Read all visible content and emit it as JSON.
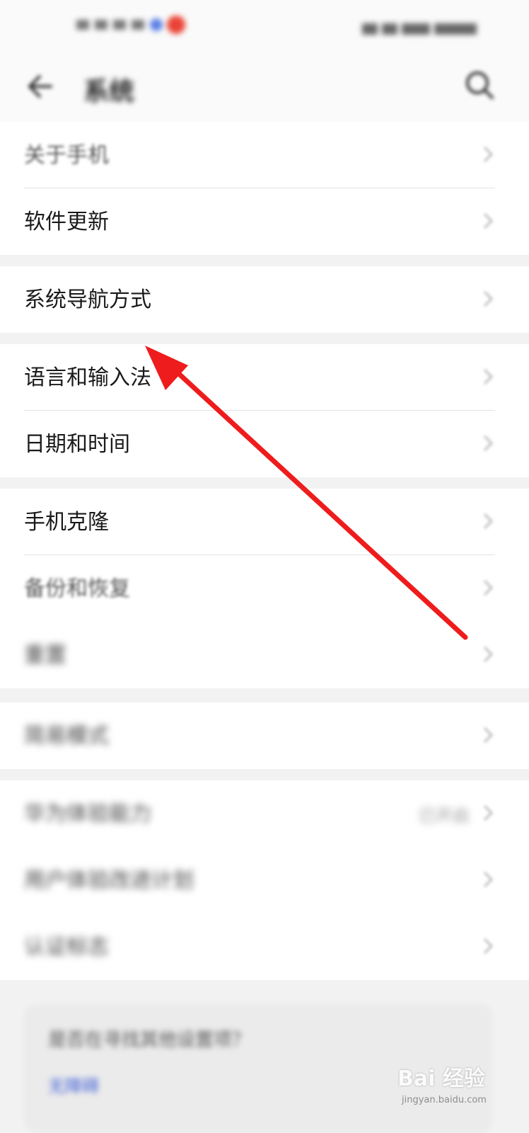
{
  "status_bar": {},
  "header": {
    "title": "系统",
    "back_icon": "arrow-left-icon",
    "search_icon": "search-icon"
  },
  "groups": [
    {
      "items": [
        {
          "label": "关于手机"
        },
        {
          "label": "软件更新"
        }
      ]
    },
    {
      "items": [
        {
          "label": "系统导航方式"
        }
      ]
    },
    {
      "items": [
        {
          "label": "语言和输入法"
        },
        {
          "label": "日期和时间"
        }
      ]
    },
    {
      "items": [
        {
          "label": "手机克隆"
        },
        {
          "label": "备份和恢复"
        },
        {
          "label": "重置"
        }
      ]
    },
    {
      "items": [
        {
          "label": "简易模式"
        }
      ]
    },
    {
      "items": [
        {
          "label": "华为体验能力",
          "value": "已开启"
        },
        {
          "label": "用户体验改进计划"
        },
        {
          "label": "认证标志"
        }
      ]
    }
  ],
  "help_card": {
    "question": "是否在寻找其他设置项？",
    "link": "无障碍"
  },
  "annotation": {
    "type": "arrow",
    "color": "#ee1c1c",
    "points_to": "系统导航方式"
  },
  "watermark": {
    "text": "Bai 经验",
    "url": "jingyan.baidu.com"
  }
}
